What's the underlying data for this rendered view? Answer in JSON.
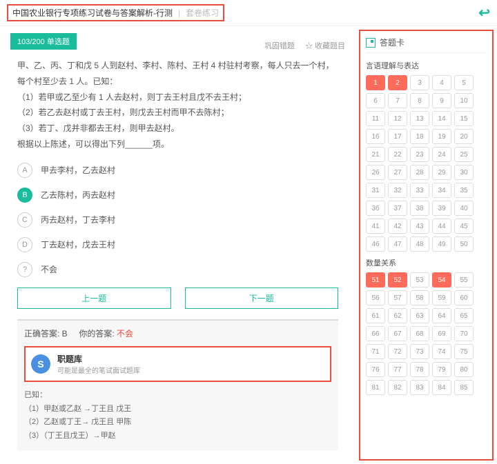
{
  "header": {
    "title": "中国农业银行专项练习试卷与答案解析-行测",
    "sub": "套卷练习"
  },
  "progress": "103/200 单选题",
  "actions": {
    "consolidate": "巩固错题",
    "favorite": "☆ 收藏题目"
  },
  "question": {
    "stem": "甲、乙、丙、丁和戊 5 人到赵村、李村、陈村、王村 4 村驻村考察，每人只去一个村，每个村至少去 1 人。已知：",
    "c1": "（1）若甲或乙至少有 1 人去赵村，则丁去王村且戊不去王村；",
    "c2": "（2）若乙去赵村或丁去王村，则戊去王村而甲不去陈村；",
    "c3": "（3）若丁、戊并非都去王村，则甲去赵村。",
    "tail": "根据以上陈述，可以得出下列______项。"
  },
  "options": [
    {
      "letter": "A",
      "text": "甲去李村，乙去赵村"
    },
    {
      "letter": "B",
      "text": "乙去陈村，丙去赵村"
    },
    {
      "letter": "C",
      "text": "丙去赵村，丁去李村"
    },
    {
      "letter": "D",
      "text": "丁去赵村，戊去王村"
    },
    {
      "letter": "?",
      "text": "不会"
    }
  ],
  "nav": {
    "prev": "上一题",
    "next": "下一题"
  },
  "answer": {
    "correct_label": "正确答案: B",
    "your_label": "你的答案:",
    "your_value": "不会"
  },
  "promo": {
    "title": "职题库",
    "sub": "可能是最全的笔试面试题库"
  },
  "explain": {
    "head": "已知：",
    "l1": "（1）甲赵或乙赵 →丁王且 戊王",
    "l2": "（2）乙赵或丁王→ 戊王且 甲陈",
    "l3": "（3）（丁王且戊王）→甲赵"
  },
  "card": {
    "title": "答题卡",
    "section1": "言语理解与表达",
    "section2": "数量关系",
    "grid1_active": [
      1,
      2
    ],
    "grid2_active": [
      51,
      52,
      54
    ]
  }
}
